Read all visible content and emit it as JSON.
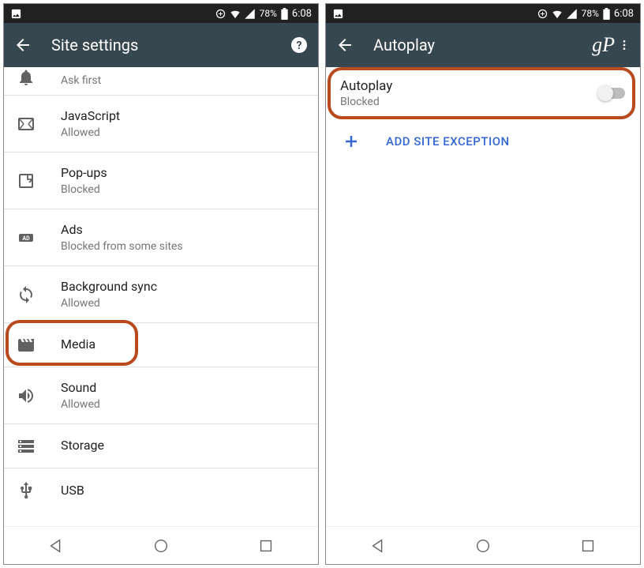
{
  "status": {
    "battery_pct": "78%",
    "time": "6:08"
  },
  "left": {
    "title": "Site settings",
    "items": [
      {
        "title": "Ask first",
        "sub": ""
      },
      {
        "title": "JavaScript",
        "sub": "Allowed"
      },
      {
        "title": "Pop-ups",
        "sub": "Blocked"
      },
      {
        "title": "Ads",
        "sub": "Blocked from some sites"
      },
      {
        "title": "Background sync",
        "sub": "Allowed"
      },
      {
        "title": "Media",
        "sub": ""
      },
      {
        "title": "Sound",
        "sub": "Allowed"
      },
      {
        "title": "Storage",
        "sub": ""
      },
      {
        "title": "USB",
        "sub": ""
      }
    ]
  },
  "right": {
    "title": "Autoplay",
    "autoplay": {
      "title": "Autoplay",
      "sub": "Blocked"
    },
    "add_label": "ADD SITE EXCEPTION",
    "watermark": "gP"
  }
}
